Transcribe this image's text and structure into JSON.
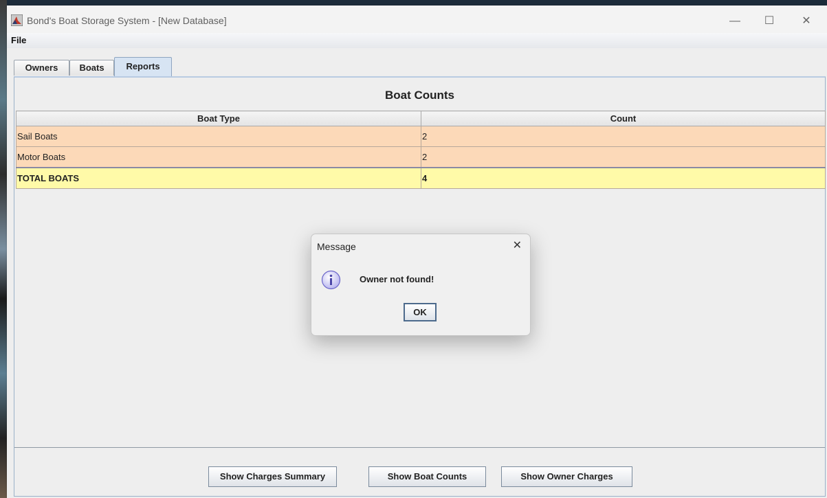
{
  "window": {
    "title": "Bond's Boat Storage System - [New Database]",
    "minimize_glyph": "—",
    "maximize_glyph": "☐",
    "close_glyph": "✕"
  },
  "menu": {
    "file": "File"
  },
  "tabs": [
    {
      "label": "Owners"
    },
    {
      "label": "Boats"
    },
    {
      "label": "Reports",
      "active": true
    }
  ],
  "report": {
    "title": "Boat Counts",
    "columns": [
      "Boat Type",
      "Count"
    ],
    "rows": [
      {
        "type": "Sail Boats",
        "count": "2"
      },
      {
        "type": "Motor Boats",
        "count": "2"
      }
    ],
    "total": {
      "type": "TOTAL BOATS",
      "count": "4"
    }
  },
  "buttons": {
    "charges_summary": "Show Charges Summary",
    "boat_counts": "Show Boat Counts",
    "owner_charges": "Show Owner Charges"
  },
  "dialog": {
    "title": "Message",
    "close_glyph": "✕",
    "message": "Owner not found!",
    "ok": "OK"
  },
  "colors": {
    "row_data": "#fcd9b8",
    "row_total": "#fffaa8",
    "active_tab": "#d7e4f3"
  }
}
